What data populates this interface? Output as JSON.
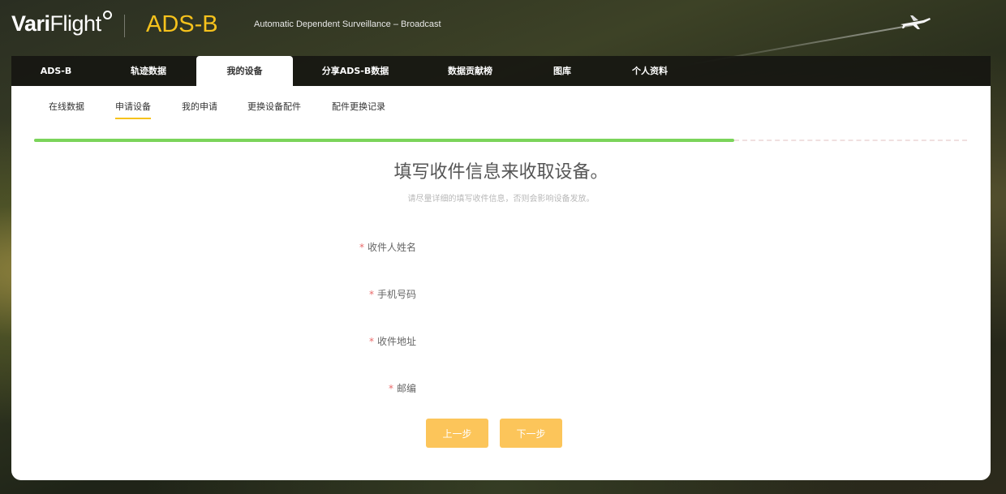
{
  "header": {
    "brand_bold": "Vari",
    "brand_light": "Flight",
    "app_name": "ADS-B",
    "subtitle": "Automatic Dependent Surveillance – Broadcast"
  },
  "topnav": {
    "tabs": [
      {
        "label": "ADS-B"
      },
      {
        "label": "轨迹数据"
      },
      {
        "label": "我的设备"
      },
      {
        "label": "分享ADS-B数据"
      },
      {
        "label": "数据贡献榜"
      },
      {
        "label": "图库"
      },
      {
        "label": "个人资料"
      }
    ],
    "active_index": 2
  },
  "subnav": {
    "items": [
      {
        "label": "在线数据"
      },
      {
        "label": "申请设备"
      },
      {
        "label": "我的申请"
      },
      {
        "label": "更换设备配件"
      },
      {
        "label": "配件更换记录"
      }
    ],
    "active_index": 1
  },
  "progress": {
    "fraction": 0.75,
    "color": "#7bd45a"
  },
  "form": {
    "title": "填写收件信息来收取设备。",
    "hint": "请尽量详细的填写收件信息，否则会影响设备发放。",
    "required_mark": "*",
    "fields": [
      {
        "label": "收件人姓名"
      },
      {
        "label": "手机号码"
      },
      {
        "label": "收件地址"
      },
      {
        "label": "邮编"
      }
    ]
  },
  "buttons": {
    "prev_label": "上一步",
    "next_label": "下一步",
    "color": "#fcc55a"
  }
}
